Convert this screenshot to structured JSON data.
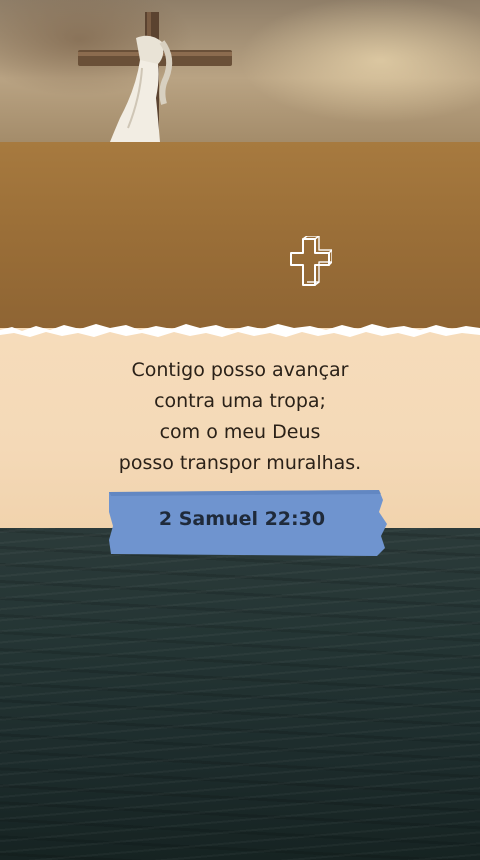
{
  "verse": {
    "lines": [
      "Contigo posso avançar",
      "contra uma tropa;",
      "com o meu Deus",
      "posso transpor muralhas."
    ]
  },
  "reference": "2 Samuel 22:30",
  "colors": {
    "paper": "#f4d9b7",
    "tape": "#6f94cf",
    "text": "#2a2118",
    "band": "#9b6f38",
    "sea": "#1d2c2c"
  },
  "icons": [
    "cross-outline-icon",
    "wooden-cross-photo"
  ]
}
